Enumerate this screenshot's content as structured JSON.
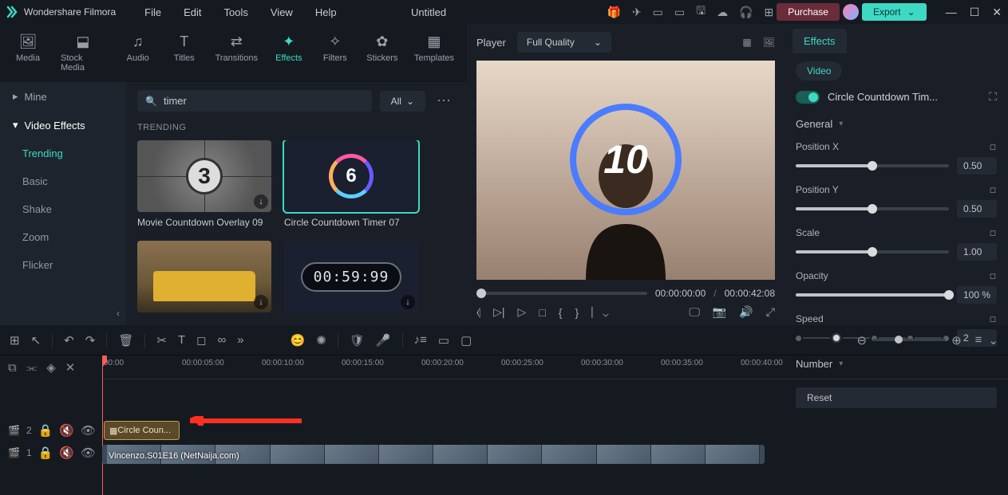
{
  "app": {
    "name": "Wondershare Filmora",
    "document": "Untitled"
  },
  "menus": [
    "File",
    "Edit",
    "Tools",
    "View",
    "Help"
  ],
  "titlebar_buttons": {
    "purchase": "Purchase",
    "export": "Export"
  },
  "library_tabs": [
    {
      "id": "media",
      "label": "Media"
    },
    {
      "id": "stock",
      "label": "Stock Media"
    },
    {
      "id": "audio",
      "label": "Audio"
    },
    {
      "id": "titles",
      "label": "Titles"
    },
    {
      "id": "transitions",
      "label": "Transitions"
    },
    {
      "id": "effects",
      "label": "Effects",
      "active": true
    },
    {
      "id": "filters",
      "label": "Filters"
    },
    {
      "id": "stickers",
      "label": "Stickers"
    },
    {
      "id": "templates",
      "label": "Templates"
    }
  ],
  "sidebar": {
    "mine": "Mine",
    "video_effects": "Video Effects",
    "categories": [
      "Trending",
      "Basic",
      "Shake",
      "Zoom",
      "Flicker"
    ]
  },
  "search": {
    "query": "timer",
    "filter": "All"
  },
  "section_header": "TRENDING",
  "cards": [
    {
      "label": "Movie Countdown Overlay 09",
      "type": "film",
      "num": "3"
    },
    {
      "label": "Circle Countdown Timer 07",
      "type": "ring",
      "num": "6",
      "selected": true
    },
    {
      "label": "",
      "type": "car"
    },
    {
      "label": "",
      "type": "digital",
      "time": "00:59:99"
    }
  ],
  "player": {
    "label": "Player",
    "quality": "Full Quality",
    "preview_number": "10",
    "current_time": "00:00:00:00",
    "total_time": "00:00:42:08"
  },
  "properties": {
    "tab": "Effects",
    "sub_tab": "Video",
    "effect_name": "Circle Countdown Tim...",
    "sections": {
      "general": {
        "label": "General",
        "position_x": {
          "label": "Position X",
          "value": "0.50",
          "pct": 50
        },
        "position_y": {
          "label": "Position Y",
          "value": "0.50",
          "pct": 50
        },
        "scale": {
          "label": "Scale",
          "value": "1.00",
          "pct": 50
        },
        "opacity": {
          "label": "Opacity",
          "value": "100",
          "unit": "%",
          "pct": 100
        },
        "speed": {
          "label": "Speed",
          "value": "2"
        }
      },
      "number": {
        "label": "Number"
      }
    },
    "reset": "Reset"
  },
  "timeline": {
    "ruler": [
      "00:00",
      "00:00:05:00",
      "00:00:10:00",
      "00:00:15:00",
      "00:00:20:00",
      "00:00:25:00",
      "00:00:30:00",
      "00:00:35:00",
      "00:00:40:00"
    ],
    "tracks": {
      "effect_track_num": "2",
      "video_track_num": "1",
      "effect_clip": "Circle Coun...",
      "video_clip": "Vincenzo.S01E16 (NetNaija.com)"
    }
  }
}
